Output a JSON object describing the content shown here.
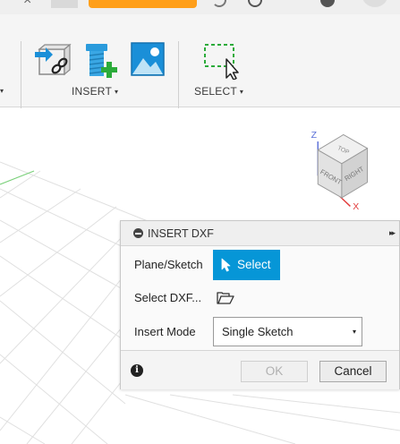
{
  "toolbar": {
    "insert_label": "INSERT",
    "select_label": "SELECT",
    "caret": "▾",
    "insert_icons": [
      "insert-derive-icon",
      "insert-mcmaster-bolt-icon",
      "insert-image-icon"
    ],
    "select_icons": [
      "window-select-icon"
    ]
  },
  "viewcube": {
    "top": "TOP",
    "front": "FRONT",
    "right": "RIGHT",
    "axis_z": "Z",
    "axis_x": "X"
  },
  "dialog": {
    "title": "INSERT DXF",
    "expand_glyph": "▸▸",
    "plane_sketch_label": "Plane/Sketch",
    "select_button_label": "Select",
    "select_dxf_label": "Select DXF...",
    "insert_mode_label": "Insert Mode",
    "insert_mode_value": "Single Sketch",
    "dropdown_arrow": "▾",
    "ok_label": "OK",
    "cancel_label": "Cancel",
    "info_glyph": "i"
  },
  "colors": {
    "accent_blue": "#0696d7",
    "orange_tab": "#ff9f1a",
    "icon_blue": "#1a8fd8",
    "icon_green": "#2bab3a",
    "axis_z": "#5a6fd8",
    "axis_x": "#e23a3a"
  }
}
